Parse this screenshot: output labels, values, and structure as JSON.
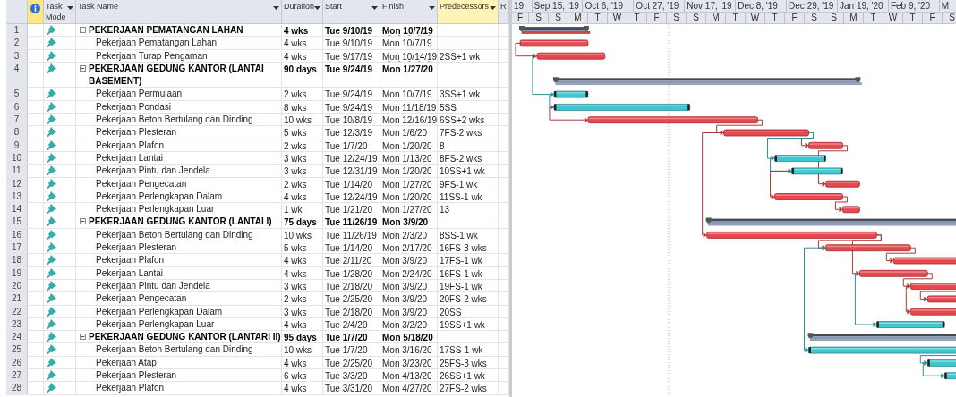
{
  "columns": [
    {
      "label": "Task Mode",
      "menu": true,
      "highlighted": false
    },
    {
      "label": "Task Name",
      "menu": true,
      "highlighted": false
    },
    {
      "label": "Duration",
      "menu": true,
      "highlighted": false
    },
    {
      "label": "Start",
      "menu": true,
      "highlighted": false
    },
    {
      "label": "Finish",
      "menu": true,
      "highlighted": false
    },
    {
      "label": "Predecessors",
      "menu": true,
      "highlighted": true
    },
    {
      "label": "R",
      "menu": false,
      "highlighted": false
    }
  ],
  "timescale": {
    "major": [
      "19",
      "Sep 15, '19",
      "Oct 6, '19",
      "Oct 27, '19",
      "Nov 17, '19",
      "Dec 8, '19",
      "Dec 29, '19",
      "Jan 19, '20",
      "Feb 9, '20",
      "M"
    ],
    "minor": [
      "F",
      "S",
      "S",
      "M",
      "T",
      "W",
      "T",
      "F",
      "S",
      "S",
      "M",
      "T",
      "W",
      "T",
      "F",
      "S",
      "S",
      "M",
      "T",
      "W",
      "T",
      "F",
      "S"
    ]
  },
  "rows": [
    {
      "id": "1",
      "kind": "summary",
      "name": "PEKERJAAN PEMATANGAN LAHAN",
      "duration": "4 wks",
      "start": "Tue 9/10/19",
      "finish": "Mon 10/7/19",
      "finish_flagged": true,
      "critical": true
    },
    {
      "id": "2",
      "kind": "task",
      "name": "Pekerjaan Pematangan Lahan",
      "duration": "4 wks",
      "start": "Tue 9/10/19",
      "finish": "Mon 10/7/19",
      "finish_flagged": false,
      "critical": true
    },
    {
      "id": "3",
      "kind": "task",
      "name": "Pekerjaan Turap Pengaman",
      "duration": "4 wks",
      "start": "Tue 9/17/19",
      "finish": "Mon 10/14/19",
      "predecessors": "2SS+1 wk",
      "finish_flagged": true,
      "critical": true
    },
    {
      "id": "4",
      "kind": "summary",
      "name": "PEKERJAAN GEDUNG KANTOR (LANTAI BASEMENT)",
      "duration": "90 days",
      "start": "Tue 9/24/19",
      "finish": "Mon 1/27/20",
      "finish_flagged": false,
      "critical": false
    },
    {
      "id": "5",
      "kind": "task",
      "name": "Pekerjaan Permulaan",
      "duration": "2 wks",
      "start": "Tue 9/24/19",
      "finish": "Mon 10/7/19",
      "predecessors": "3SS+1 wk",
      "finish_flagged": false,
      "critical": false
    },
    {
      "id": "6",
      "kind": "task",
      "name": "Pekerjaan Pondasi",
      "duration": "8 wks",
      "start": "Tue 9/24/19",
      "finish": "Mon 11/18/19",
      "predecessors": "5SS",
      "finish_flagged": false,
      "critical": false
    },
    {
      "id": "7",
      "kind": "task",
      "name": "Pekerjaan Beton Bertulang dan Dinding",
      "duration": "10 wks",
      "start": "Tue 10/8/19",
      "finish": "Mon 12/16/19",
      "predecessors": "6SS+2 wks",
      "finish_flagged": false,
      "critical": true
    },
    {
      "id": "8",
      "kind": "task",
      "name": "Pekerjaan Plesteran",
      "duration": "5 wks",
      "start": "Tue 12/3/19",
      "finish": "Mon 1/6/20",
      "predecessors": "7FS-2 wks",
      "finish_flagged": false,
      "critical": true
    },
    {
      "id": "9",
      "kind": "task",
      "name": "Pekerjaan Plafon",
      "duration": "2 wks",
      "start": "Tue 1/7/20",
      "finish": "Mon 1/20/20",
      "predecessors": "8",
      "finish_flagged": false,
      "critical": true
    },
    {
      "id": "10",
      "kind": "task",
      "name": "Pekerjaan Lantai",
      "duration": "3 wks",
      "start": "Tue 12/24/19",
      "finish": "Mon 1/13/20",
      "predecessors": "8FS-2 wks",
      "finish_flagged": false,
      "critical": false
    },
    {
      "id": "11",
      "kind": "task",
      "name": "Pekerjaan Pintu dan Jendela",
      "duration": "3 wks",
      "start": "Tue 12/31/19",
      "finish": "Mon 1/20/20",
      "predecessors": "10SS+1 wk",
      "finish_flagged": false,
      "critical": false
    },
    {
      "id": "12",
      "kind": "task",
      "name": "Pekerjaan Pengecatan",
      "duration": "2 wks",
      "start": "Tue 1/14/20",
      "finish": "Mon 1/27/20",
      "predecessors": "9FS-1 wk",
      "finish_flagged": false,
      "critical": true
    },
    {
      "id": "13",
      "kind": "task",
      "name": "Pekerjaan Perlengkapan Dalam",
      "duration": "4 wks",
      "start": "Tue 12/24/19",
      "finish": "Mon 1/20/20",
      "predecessors": "11SS-1 wk",
      "finish_flagged": false,
      "critical": true
    },
    {
      "id": "14",
      "kind": "task",
      "name": "Pekerjaan Perlengkapan Luar",
      "duration": "1 wk",
      "start": "Tue 1/21/20",
      "finish": "Mon 1/27/20",
      "predecessors": "13",
      "finish_flagged": false,
      "critical": true
    },
    {
      "id": "15",
      "kind": "summary",
      "name": "PEKERJAAN GEDUNG KANTOR (LANTAI I)",
      "duration": "75 days",
      "start": "Tue 11/26/19",
      "finish": "Mon 3/9/20",
      "finish_flagged": false,
      "critical": false
    },
    {
      "id": "16",
      "kind": "task",
      "name": "Pekerjaan Beton Bertulang dan Dinding",
      "duration": "10 wks",
      "start": "Tue 11/26/19",
      "finish": "Mon 2/3/20",
      "predecessors": "8SS-1 wk",
      "finish_flagged": false,
      "critical": true
    },
    {
      "id": "17",
      "kind": "task",
      "name": "Pekerjaan Plesteran",
      "duration": "5 wks",
      "start": "Tue 1/14/20",
      "finish": "Mon 2/17/20",
      "predecessors": "16FS-3 wks",
      "finish_flagged": false,
      "critical": true
    },
    {
      "id": "18",
      "kind": "task",
      "name": "Pekerjaan Plafon",
      "duration": "4 wks",
      "start": "Tue 2/11/20",
      "finish": "Mon 3/9/20",
      "predecessors": "17FS-1 wk",
      "finish_flagged": false,
      "critical": true
    },
    {
      "id": "19",
      "kind": "task",
      "name": "Pekerjaan Lantai",
      "duration": "4 wks",
      "start": "Tue 1/28/20",
      "finish": "Mon 2/24/20",
      "predecessors": "16FS-1 wk",
      "finish_flagged": false,
      "critical": true
    },
    {
      "id": "20",
      "kind": "task",
      "name": "Pekerjaan Pintu dan Jendela",
      "duration": "3 wks",
      "start": "Tue 2/18/20",
      "finish": "Mon 3/9/20",
      "predecessors": "19FS-1 wk",
      "finish_flagged": false,
      "critical": true
    },
    {
      "id": "21",
      "kind": "task",
      "name": "Pekerjaan Pengecatan",
      "duration": "2 wks",
      "start": "Tue 2/25/20",
      "finish": "Mon 3/9/20",
      "predecessors": "20FS-2 wks",
      "finish_flagged": false,
      "critical": true
    },
    {
      "id": "22",
      "kind": "task",
      "name": "Pekerjaan Perlengkapan Dalam",
      "duration": "3 wks",
      "start": "Tue 2/18/20",
      "finish": "Mon 3/9/20",
      "predecessors": "20SS",
      "finish_flagged": false,
      "critical": true
    },
    {
      "id": "23",
      "kind": "task",
      "name": "Pekerjaan Perlengkapan Luar",
      "duration": "4 wks",
      "start": "Tue 2/4/20",
      "finish": "Mon 3/2/20",
      "predecessors": "19SS+1 wk",
      "finish_flagged": false,
      "critical": false
    },
    {
      "id": "24",
      "kind": "summary",
      "name": "PEKERJAAN GEDUNG KANTOR (LANTARI II)",
      "duration": "95 days",
      "start": "Tue 1/7/20",
      "finish": "Mon 5/18/20",
      "finish_flagged": false,
      "critical": false
    },
    {
      "id": "25",
      "kind": "task",
      "name": "Pekerjaan Beton Bertulang dan Dinding",
      "duration": "10 wks",
      "start": "Tue 1/7/20",
      "finish": "Mon 3/16/20",
      "predecessors": "17SS-1 wk",
      "finish_flagged": false,
      "critical": false
    },
    {
      "id": "26",
      "kind": "task",
      "name": "Pekerjaan Atap",
      "duration": "4 wks",
      "start": "Tue 2/25/20",
      "finish": "Mon 3/23/20",
      "predecessors": "25FS-3 wks",
      "finish_flagged": false,
      "critical": false
    },
    {
      "id": "27",
      "kind": "task",
      "name": "Pekerjaan Plesteran",
      "duration": "6 wks",
      "start": "Tue 3/3/20",
      "finish": "Mon 4/13/20",
      "predecessors": "26SS+1 wk",
      "finish_flagged": false,
      "critical": false
    },
    {
      "id": "28",
      "kind": "task",
      "name": "Pekerjaan Plafon",
      "duration": "4 wks",
      "start": "Tue 3/31/20",
      "finish": "Mon 4/27/20",
      "predecessors": "27FS-2 wks",
      "finish_flagged": false
    }
  ]
}
